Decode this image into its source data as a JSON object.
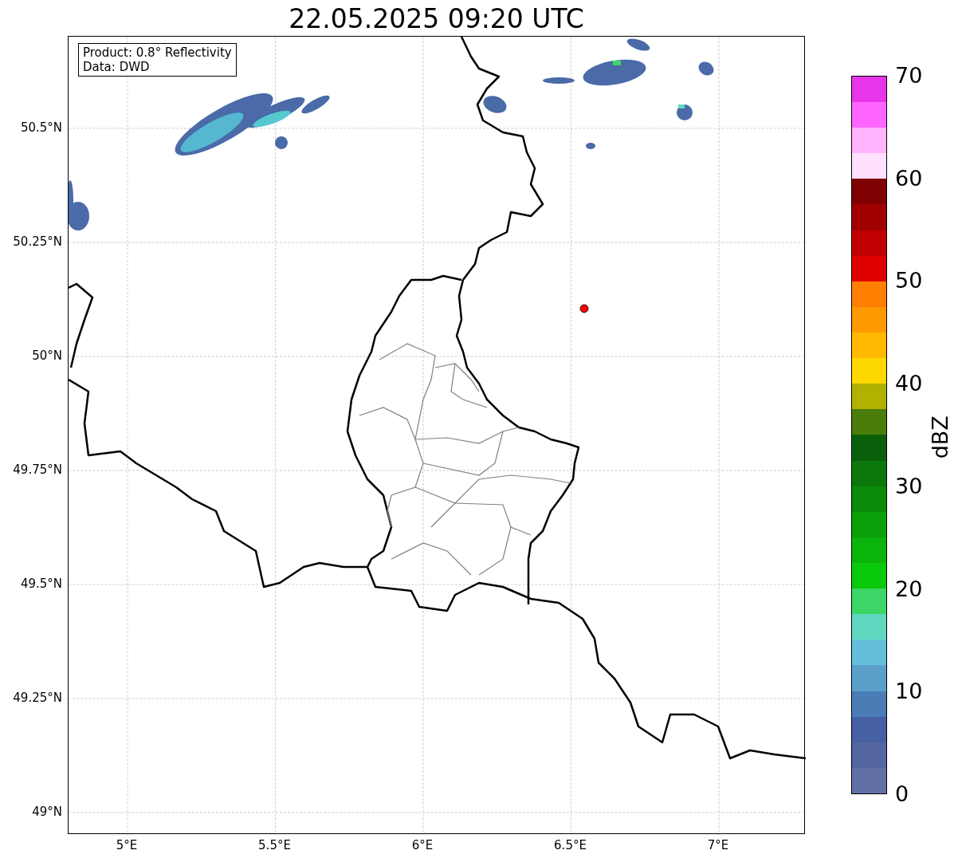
{
  "title": "22.05.2025 09:20 UTC",
  "info_box": [
    "Product: 0.8° Reflectivity",
    "Data: DWD"
  ],
  "map": {
    "y_ticks": [
      "50.5°N",
      "50.25°N",
      "50°N",
      "49.75°N",
      "49.5°N",
      "49.25°N",
      "49°N"
    ],
    "x_ticks": [
      "5°E",
      "5.5°E",
      "6°E",
      "6.5°E",
      "7°E"
    ]
  },
  "colorbar": {
    "label": "dBZ",
    "ticks": [
      "70",
      "60",
      "50",
      "40",
      "30",
      "20",
      "10",
      "0"
    ],
    "bands": [
      {
        "color": "#6270a8"
      },
      {
        "color": "#5366a0"
      },
      {
        "color": "#4560a3"
      },
      {
        "color": "#4a7db5"
      },
      {
        "color": "#5a9fc8"
      },
      {
        "color": "#64c0da"
      },
      {
        "color": "#60d8c0"
      },
      {
        "color": "#3cd666"
      },
      {
        "color": "#0ac80a"
      },
      {
        "color": "#0ab40a"
      },
      {
        "color": "#0aa00a"
      },
      {
        "color": "#0a8c0a"
      },
      {
        "color": "#0a780a"
      },
      {
        "color": "#0a5f0a"
      },
      {
        "color": "#4a7d0a"
      },
      {
        "color": "#b1b100"
      },
      {
        "color": "#ffd800"
      },
      {
        "color": "#ffb900"
      },
      {
        "color": "#ff9900"
      },
      {
        "color": "#ff7f00"
      },
      {
        "color": "#e00000"
      },
      {
        "color": "#c00000"
      },
      {
        "color": "#a00000"
      },
      {
        "color": "#7f0000"
      },
      {
        "color": "#ffe0ff"
      },
      {
        "color": "#ffb3ff"
      },
      {
        "color": "#ff66ff"
      },
      {
        "color": "#e935e9"
      }
    ]
  }
}
